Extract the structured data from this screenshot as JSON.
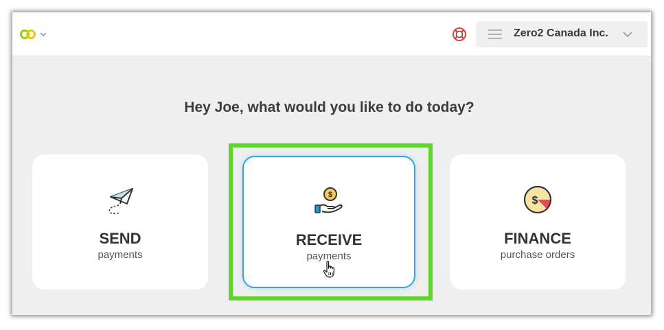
{
  "header": {
    "company_name": "Zero2 Canada Inc."
  },
  "greeting": "Hey Joe, what would you like to do today?",
  "cards": [
    {
      "title": "SEND",
      "subtitle": "payments",
      "icon": "paper-plane-icon"
    },
    {
      "title": "RECEIVE",
      "subtitle": "payments",
      "icon": "hand-coin-icon"
    },
    {
      "title": "FINANCE",
      "subtitle": "purchase orders",
      "icon": "dollar-gauge-icon"
    }
  ],
  "colors": {
    "highlight": "#5ed62a",
    "selected_border": "#28a8e8",
    "logo_green": "#8fd400",
    "logo_yellow": "#f5c400"
  }
}
